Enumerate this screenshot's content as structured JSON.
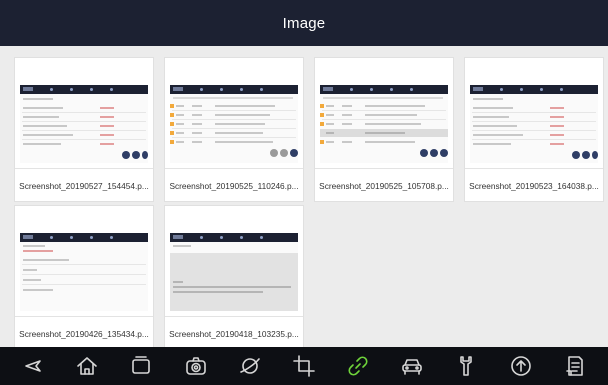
{
  "header": {
    "title": "Image"
  },
  "gallery": {
    "items": [
      {
        "caption": "Screenshot_20190527_154454.p..."
      },
      {
        "caption": "Screenshot_20190525_110246.p..."
      },
      {
        "caption": "Screenshot_20190525_105708.p..."
      },
      {
        "caption": "Screenshot_20190523_164038.p..."
      },
      {
        "caption": "Screenshot_20190426_135434.p..."
      },
      {
        "caption": "Screenshot_20190418_103235.p..."
      }
    ]
  },
  "navbar": {
    "icons": [
      "back-icon",
      "home-icon",
      "recent-apps-icon",
      "camera-icon",
      "browser-icon",
      "crop-icon",
      "link-icon",
      "car-icon",
      "wrench-icon",
      "upload-icon",
      "document-icon"
    ],
    "active": "link-icon",
    "active_color": "#6fd33b"
  },
  "colors": {
    "header_bg": "#1c2132",
    "gallery_bg": "#ececec",
    "navbar_bg": "#0d0f14"
  }
}
